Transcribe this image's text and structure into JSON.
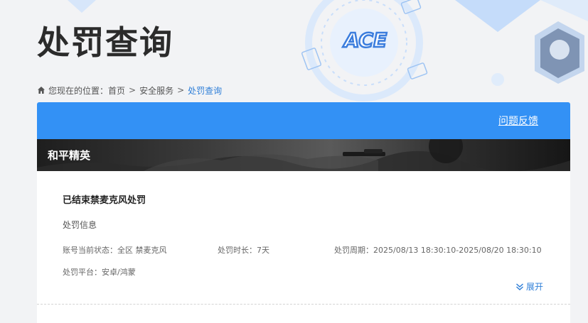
{
  "header": {
    "title": "处罚查询",
    "logo_text": "ACE"
  },
  "breadcrumb": {
    "prefix": "您现在的位置：",
    "items": [
      "首页",
      "安全服务"
    ],
    "current": "处罚查询",
    "separator": ">"
  },
  "card": {
    "feedback_label": "问题反馈",
    "game_name": "和平精英",
    "record": {
      "title": "已结束禁麦克风处罚",
      "section_label": "处罚信息",
      "status": "账号当前状态：全区 禁麦克风",
      "duration": "处罚时长：7天",
      "period": "处罚周期：2025/08/13 18:30:10-2025/08/20 18:30:10",
      "platform": "处罚平台：安卓/鸿蒙",
      "expand_label": "展开"
    }
  },
  "colors": {
    "accent": "#3391f5",
    "link": "#2f7fd8"
  },
  "icons": [
    "home-icon",
    "double-chevron-down-icon"
  ]
}
